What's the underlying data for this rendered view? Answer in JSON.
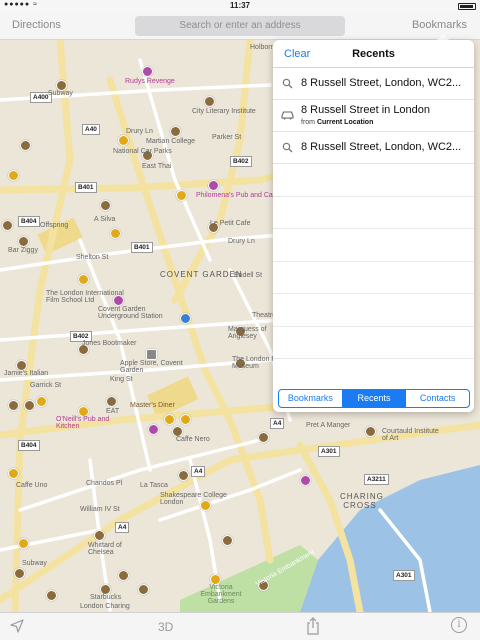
{
  "status_bar": {
    "time": "11:37"
  },
  "nav": {
    "directions_label": "Directions",
    "search_placeholder": "Search or enter an address",
    "bookmarks_label": "Bookmarks"
  },
  "map": {
    "labels": [
      "Holborn Underground Station",
      "Rudys Revenge",
      "A400",
      "City Literary Institute",
      "Subway",
      "A40",
      "Drury Ln",
      "Martian College",
      "National Car Parks",
      "East Thai",
      "Parker St",
      "B402",
      "B401",
      "Philomena's Pub and Cafe",
      "A Silva",
      "B404",
      "Offspring",
      "Bar Ziggy",
      "Le Petit Cafe",
      "Shelton St",
      "B401",
      "Drury Ln",
      "COVENT GARDEN",
      "Endell St",
      "The London International Film School Ltd",
      "Covent Garden Underground Station",
      "B402",
      "Jones Bootmaker",
      "Marquess of Anglesey",
      "Theatre",
      "Jamie's Italian",
      "Apple Store, Covent Garden",
      "The London Film Museum",
      "Garrick St",
      "King St",
      "Master's Diner",
      "EAT",
      "O'Neill's Pub and Kitchen",
      "Caffe Nero",
      "A4",
      "Pret A Manger",
      "Courtauld Institute of Art",
      "B404",
      "A4",
      "A301",
      "La Tasca",
      "Shakespeare College London",
      "A3211",
      "Caffe Uno",
      "Chandos Pl",
      "CHARING CROSS",
      "William IV St",
      "A4",
      "Whittard of Chelsea",
      "A301",
      "Victoria Embankment",
      "Subway",
      "Starbucks",
      "Victoria Embankment Gardens",
      "London Charing"
    ]
  },
  "recents": {
    "clear_label": "Clear",
    "title": "Recents",
    "items": [
      {
        "icon": "search-icon",
        "title": "8 Russell Street, London, WC2...",
        "subtitle": ""
      },
      {
        "icon": "car-icon",
        "title": "8 Russell Street in London",
        "subtitle_prefix": "from",
        "subtitle": "Current Location"
      },
      {
        "icon": "search-icon",
        "title": "8 Russell Street, London, WC2...",
        "subtitle": ""
      }
    ],
    "tabs": [
      {
        "label": "Bookmarks",
        "active": false
      },
      {
        "label": "Recents",
        "active": true
      },
      {
        "label": "Contacts",
        "active": false
      }
    ],
    "accent_color": "#1a7bf2"
  },
  "toolbar": {
    "three_d_label": "3D",
    "info_label": "i"
  }
}
